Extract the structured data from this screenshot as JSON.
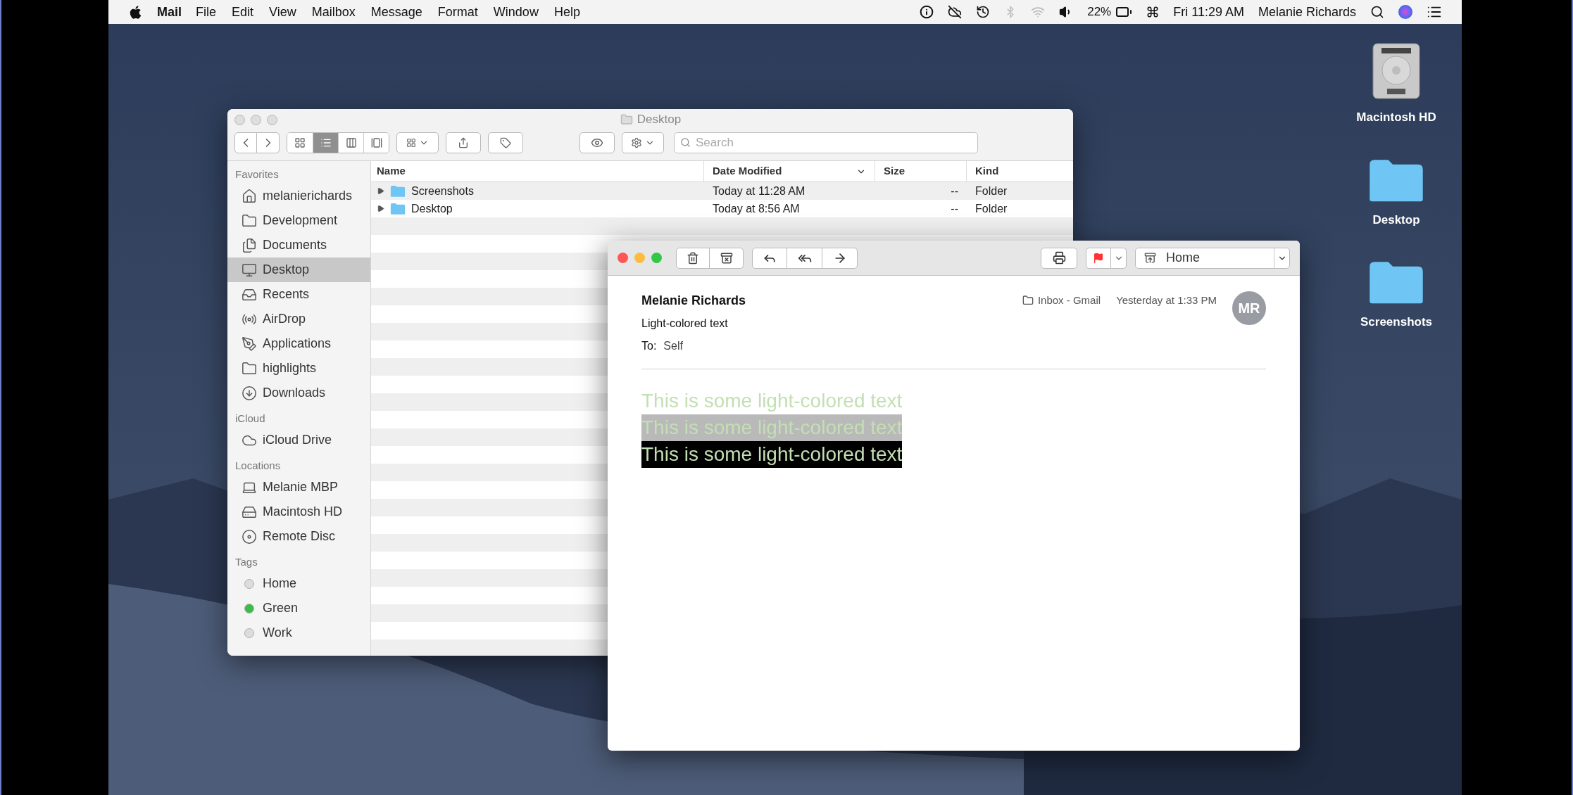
{
  "menu_bar": {
    "app": "Mail",
    "items": [
      "File",
      "Edit",
      "View",
      "Mailbox",
      "Message",
      "Format",
      "Window",
      "Help"
    ],
    "battery": "22%",
    "clock": "Fri 11:29 AM",
    "user": "Melanie Richards"
  },
  "finder": {
    "title": "Desktop",
    "search": {
      "placeholder": "Search"
    },
    "view_modes": [
      {
        "kind": "icons",
        "selected": false
      },
      {
        "kind": "list",
        "selected": true
      },
      {
        "kind": "columns",
        "selected": false
      },
      {
        "kind": "gallery",
        "selected": false
      }
    ],
    "sidebar": [
      {
        "heading": "Favorites",
        "items": [
          {
            "label": "melanierichards",
            "kind": "home",
            "selected": false
          },
          {
            "label": "Development",
            "kind": "folder",
            "selected": false
          },
          {
            "label": "Documents",
            "kind": "documents",
            "selected": false
          },
          {
            "label": "Desktop",
            "kind": "desktop",
            "selected": true
          },
          {
            "label": "Recents",
            "kind": "recents",
            "selected": false
          },
          {
            "label": "AirDrop",
            "kind": "airdrop",
            "selected": false
          },
          {
            "label": "Applications",
            "kind": "apps",
            "selected": false
          },
          {
            "label": "highlights",
            "kind": "folder",
            "selected": false
          },
          {
            "label": "Downloads",
            "kind": "downloads",
            "selected": false
          }
        ]
      },
      {
        "heading": "iCloud",
        "items": [
          {
            "label": "iCloud Drive",
            "kind": "cloud",
            "selected": false
          }
        ]
      },
      {
        "heading": "Locations",
        "items": [
          {
            "label": "Melanie MBP",
            "kind": "laptop",
            "selected": false
          },
          {
            "label": "Macintosh HD",
            "kind": "disk",
            "selected": false
          },
          {
            "label": "Remote Disc",
            "kind": "disc",
            "selected": false
          }
        ]
      },
      {
        "heading": "Tags",
        "items": [
          {
            "label": "Home",
            "kind": "tag",
            "color": "#dcdcdc",
            "selected": false
          },
          {
            "label": "Green",
            "kind": "tag",
            "color": "#3dbb4a",
            "selected": false
          },
          {
            "label": "Work",
            "kind": "tag",
            "color": "#dcdcdc",
            "selected": false
          }
        ]
      }
    ],
    "columns": [
      "Name",
      "Date Modified",
      "Size",
      "Kind"
    ],
    "rows": [
      {
        "name": "Screenshots",
        "date": "Today at 11:28 AM",
        "size": "--",
        "kind": "Folder"
      },
      {
        "name": "Desktop",
        "date": "Today at 8:56 AM",
        "size": "--",
        "kind": "Folder"
      }
    ]
  },
  "mail": {
    "sender": "Melanie Richards",
    "subject": "Light-colored text",
    "to_label": "To:",
    "to": "Self",
    "mailbox": "Inbox - Gmail",
    "date": "Yesterday at 1:33 PM",
    "avatar": "MR",
    "move_to": "Home",
    "body": [
      {
        "text": "This is some light-colored text",
        "kind": "plain"
      },
      {
        "text": "This is some light-colored text",
        "kind": "gray"
      },
      {
        "text": "This is some light-colored text",
        "kind": "black"
      }
    ]
  },
  "desktop_icons": [
    {
      "label": "Macintosh HD",
      "kind": "disk"
    },
    {
      "label": "Desktop",
      "kind": "folder"
    },
    {
      "label": "Screenshots",
      "kind": "folder"
    }
  ]
}
